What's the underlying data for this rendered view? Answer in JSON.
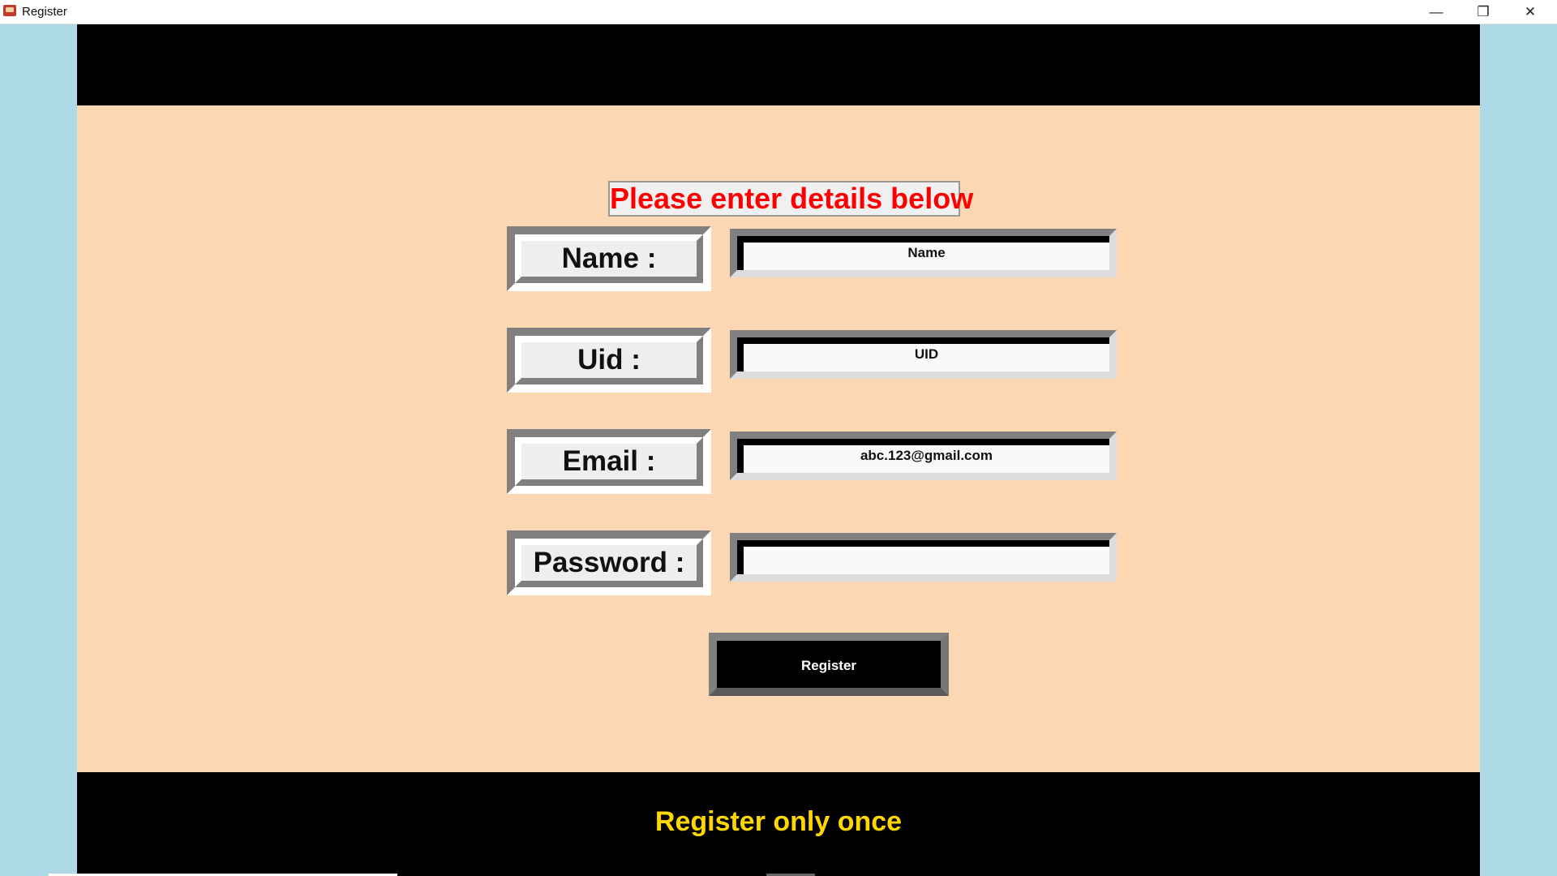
{
  "window": {
    "title": "Register",
    "controls": {
      "minimize": "—",
      "restore": "❐",
      "close": "✕"
    }
  },
  "colors": {
    "side_gutter": "#add8e6",
    "header_footer_band": "#000000",
    "content_background": "#fdd7b4",
    "heading_text": "#ff0000",
    "footer_text": "#ffd700",
    "button_background": "#000000",
    "button_text": "#ffffff"
  },
  "form": {
    "heading": "Please enter details below",
    "fields": {
      "name": {
        "label": "Name :",
        "value": "Name"
      },
      "uid": {
        "label": "Uid :",
        "value": "UID"
      },
      "email": {
        "label": "Email :",
        "value": "abc.123@gmail.com"
      },
      "password": {
        "label": "Password :",
        "value": ""
      }
    },
    "submit_label": "Register"
  },
  "footer": {
    "text": "Register only once"
  }
}
